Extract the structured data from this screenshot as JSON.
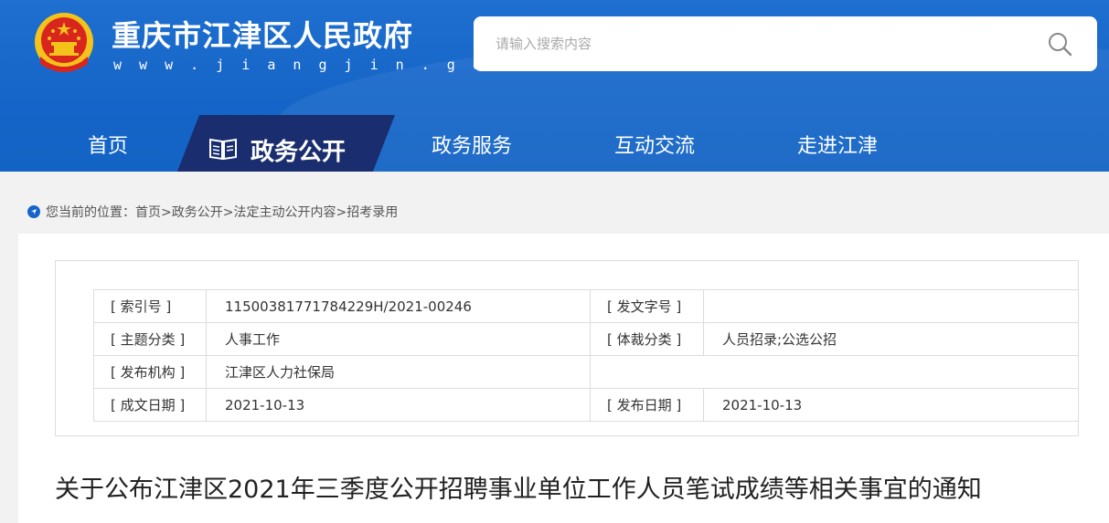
{
  "site": {
    "title": "重庆市江津区人民政府",
    "url": "w w w . j i a n g j i n . g o v . c n"
  },
  "search": {
    "placeholder": "请输入搜索内容",
    "value": ""
  },
  "nav": {
    "items": [
      "首页",
      "政务公开",
      "政务服务",
      "互动交流",
      "走进江津"
    ],
    "active": "政务公开"
  },
  "breadcrumb": {
    "text": "您当前的位置：首页>政务公开>法定主动公开内容>招考录用"
  },
  "info": {
    "index_label": "[ 索引号 ]",
    "index_value": "11500381771784229H/2021-00246",
    "doc_no_label": "[ 发文字号 ]",
    "doc_no_value": "",
    "topic_label": "[ 主题分类 ]",
    "topic_value": "人事工作",
    "genre_label": "[ 体裁分类 ]",
    "genre_value": "人员招录;公选公招",
    "org_label": "[ 发布机构 ]",
    "org_value": "江津区人力社保局",
    "created_label": "[ 成文日期 ]",
    "created_value": "2021-10-13",
    "published_label": "[ 发布日期 ]",
    "published_value": "2021-10-13"
  },
  "article": {
    "title": "关于公布江津区2021年三季度公开招聘事业单位工作人员笔试成绩等相关事宜的通知"
  },
  "colors": {
    "header_blue": "#1565c8",
    "nav_active_bg": "#1a2d6e",
    "emblem_red": "#d8261e",
    "emblem_gold": "#f5c21b"
  },
  "icons": [
    "national-emblem-icon",
    "search-icon",
    "book-icon",
    "location-icon"
  ]
}
